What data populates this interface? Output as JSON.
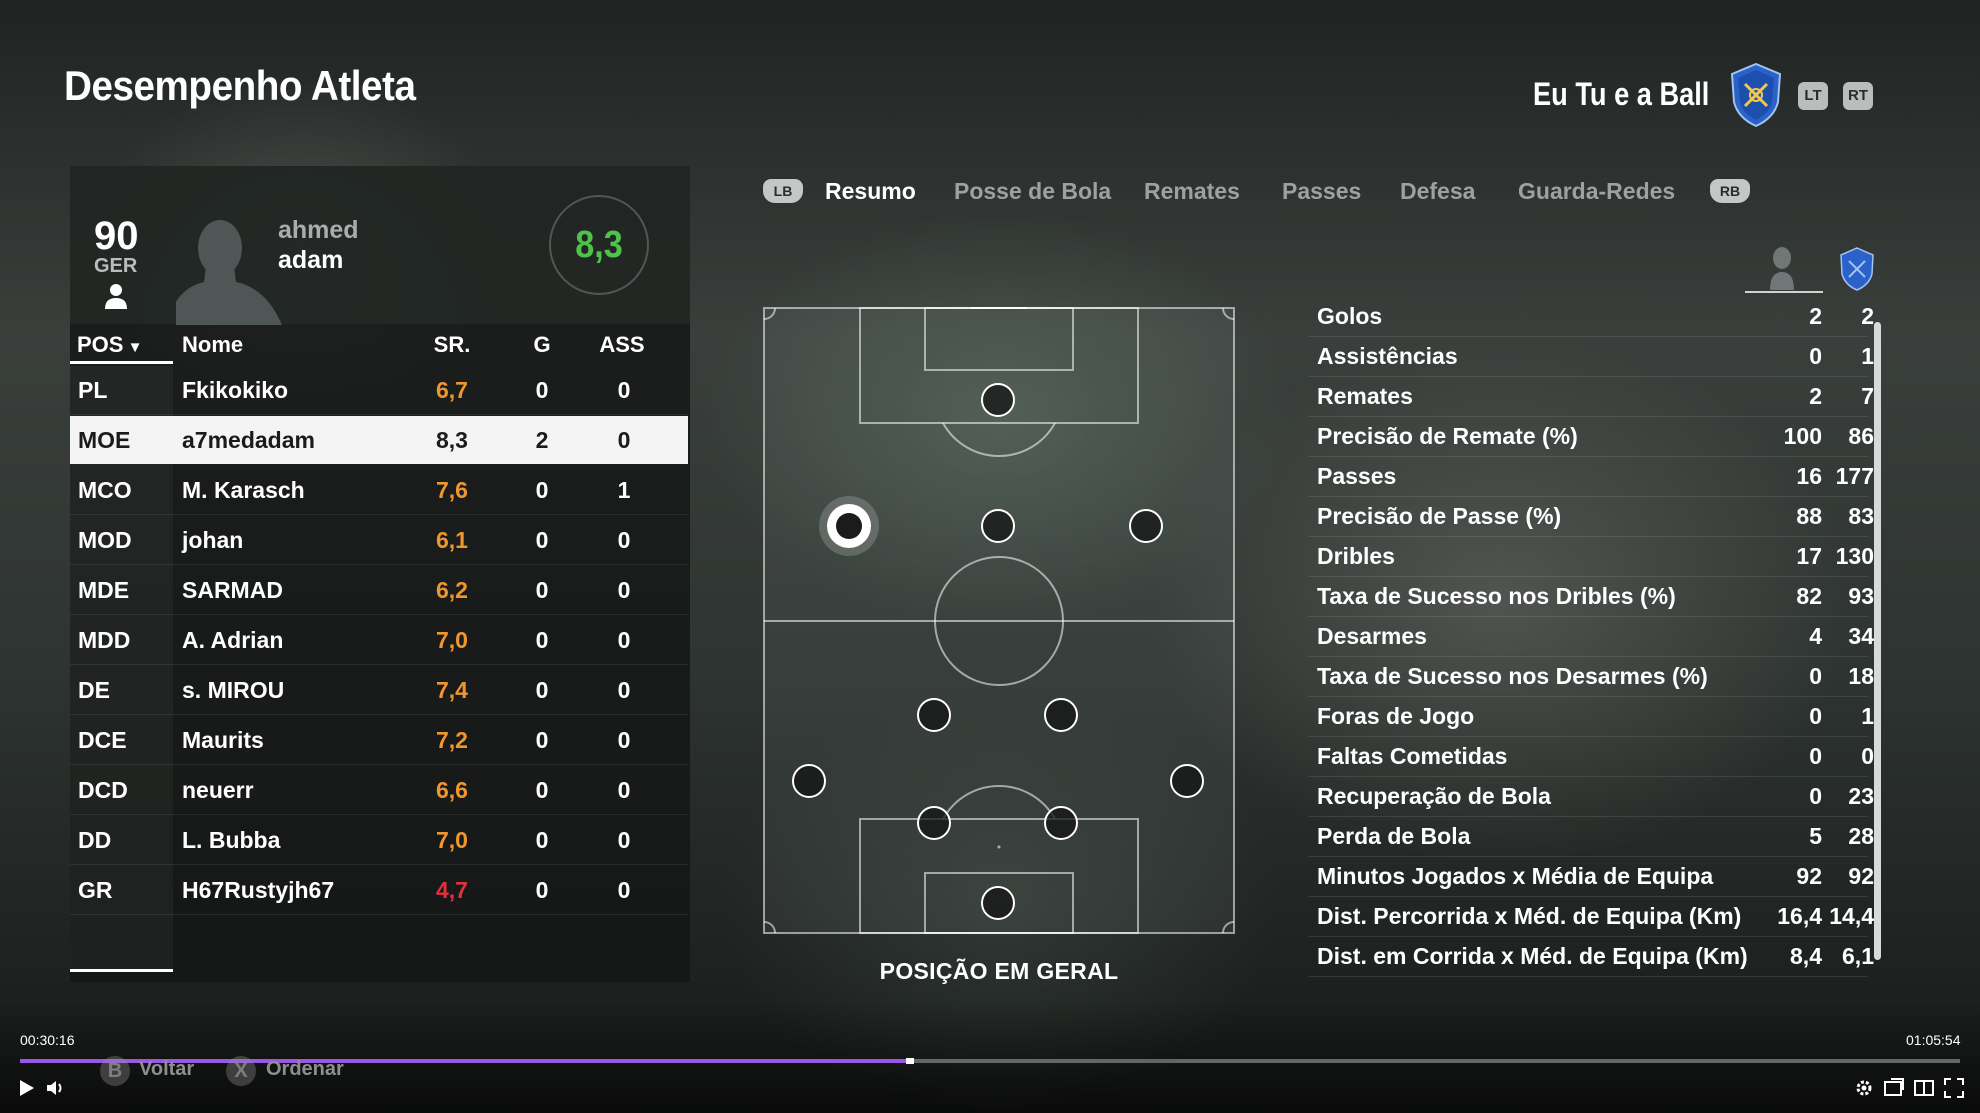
{
  "header": {
    "title": "Desempenho Atleta",
    "team_name": "Eu Tu e a Ball",
    "trigger_left": "LT",
    "trigger_right": "RT"
  },
  "player_card": {
    "overall": "90",
    "nation": "GER",
    "first_name": "ahmed",
    "last_name": "adam",
    "rating": "8,3"
  },
  "table": {
    "headers": {
      "pos": "POS",
      "name": "Nome",
      "sr": "SR.",
      "g": "G",
      "ass": "ASS"
    },
    "rows": [
      {
        "pos": "PL",
        "name": "Fkikokiko",
        "sr": "6,7",
        "g": "0",
        "ass": "0",
        "sr_color": "orange"
      },
      {
        "pos": "MOE",
        "name": "a7medadam",
        "sr": "8,3",
        "g": "2",
        "ass": "0",
        "sr_color": "white",
        "selected": true
      },
      {
        "pos": "MCO",
        "name": "M. Karasch",
        "sr": "7,6",
        "g": "0",
        "ass": "1",
        "sr_color": "orange"
      },
      {
        "pos": "MOD",
        "name": "johan",
        "sr": "6,1",
        "g": "0",
        "ass": "0",
        "sr_color": "orange"
      },
      {
        "pos": "MDE",
        "name": "SARMAD",
        "sr": "6,2",
        "g": "0",
        "ass": "0",
        "sr_color": "orange"
      },
      {
        "pos": "MDD",
        "name": "A. Adrian",
        "sr": "7,0",
        "g": "0",
        "ass": "0",
        "sr_color": "orange"
      },
      {
        "pos": "DE",
        "name": "s. MIROU",
        "sr": "7,4",
        "g": "0",
        "ass": "0",
        "sr_color": "orange"
      },
      {
        "pos": "DCE",
        "name": "Maurits",
        "sr": "7,2",
        "g": "0",
        "ass": "0",
        "sr_color": "orange"
      },
      {
        "pos": "DCD",
        "name": "neuerr",
        "sr": "6,6",
        "g": "0",
        "ass": "0",
        "sr_color": "orange"
      },
      {
        "pos": "DD",
        "name": "L. Bubba",
        "sr": "7,0",
        "g": "0",
        "ass": "0",
        "sr_color": "orange"
      },
      {
        "pos": "GR",
        "name": "H67Rustyjh67",
        "sr": "4,7",
        "g": "0",
        "ass": "0",
        "sr_color": "red"
      }
    ]
  },
  "tabs": {
    "left_bumper": "LB",
    "right_bumper": "RB",
    "items": [
      "Resumo",
      "Posse de Bola",
      "Remates",
      "Passes",
      "Defesa",
      "Guarda-Redes"
    ],
    "active": "Resumo"
  },
  "pitch": {
    "label": "POSIÇÃO EM GERAL",
    "active_position": "MOE"
  },
  "stats": [
    {
      "label": "Golos",
      "player": "2",
      "team": "2"
    },
    {
      "label": "Assistências",
      "player": "0",
      "team": "1"
    },
    {
      "label": "Remates",
      "player": "2",
      "team": "7"
    },
    {
      "label": "Precisão de Remate (%)",
      "player": "100",
      "team": "86"
    },
    {
      "label": "Passes",
      "player": "16",
      "team": "177"
    },
    {
      "label": "Precisão de Passe (%)",
      "player": "88",
      "team": "83"
    },
    {
      "label": "Dribles",
      "player": "17",
      "team": "130"
    },
    {
      "label": "Taxa de Sucesso nos Dribles (%)",
      "player": "82",
      "team": "93"
    },
    {
      "label": "Desarmes",
      "player": "4",
      "team": "34"
    },
    {
      "label": "Taxa de Sucesso nos Desarmes (%)",
      "player": "0",
      "team": "18"
    },
    {
      "label": "Foras de Jogo",
      "player": "0",
      "team": "1"
    },
    {
      "label": "Faltas Cometidas",
      "player": "0",
      "team": "0"
    },
    {
      "label": "Recuperação de Bola",
      "player": "0",
      "team": "23"
    },
    {
      "label": "Perda de Bola",
      "player": "5",
      "team": "28"
    },
    {
      "label": "Minutos Jogados x Média de Equipa",
      "player": "92",
      "team": "92"
    },
    {
      "label": "Dist. Percorrida x Méd. de Equipa (Km)",
      "player": "16,4",
      "team": "14,4"
    },
    {
      "label": "Dist. em Corrida x Méd. de Equipa (Km)",
      "player": "8,4",
      "team": "6,1"
    }
  ],
  "controls": {
    "back_key": "B",
    "back_label": "Voltar",
    "sort_key": "X",
    "sort_label": "Ordenar"
  },
  "video": {
    "current_time": "00:30:16",
    "total_time": "01:05:54",
    "progress": 0.459,
    "accent": "#9b56e8"
  },
  "colors": {
    "rating_green": "#4fc24a",
    "rating_orange": "#f0962e",
    "rating_red": "#e0323a",
    "crest_blue": "#2a62c9",
    "crest_yellow": "#f2c94c"
  }
}
